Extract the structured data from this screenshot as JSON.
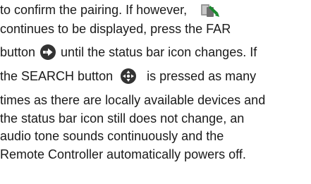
{
  "document": {
    "lines": [
      {
        "segments": [
          {
            "text": "to confirm the pairing. If however, "
          }
        ],
        "icon_after": "status-bar-pairing-icon"
      },
      {
        "segments": [
          {
            "text": "continues to be displayed, press the FAR"
          }
        ]
      },
      {
        "segments": [
          {
            "text": "button"
          },
          {
            "text": "until the status bar icon changes. If"
          }
        ],
        "icon_between": "far-button-icon"
      },
      {
        "segments": [
          {
            "text": "the SEARCH button"
          },
          {
            "text": "is pressed as many"
          }
        ],
        "icon_between": "search-button-icon"
      },
      {
        "segments": [
          {
            "text": "times as there are locally available devices and"
          }
        ]
      },
      {
        "segments": [
          {
            "text": "the status bar icon still does not change, an"
          }
        ]
      },
      {
        "segments": [
          {
            "text": "audio tone sounds continuously and the"
          }
        ]
      },
      {
        "segments": [
          {
            "text": "Remote Controller automatically powers off."
          }
        ]
      }
    ]
  },
  "colors": {
    "text": "#1a1a1a",
    "icon_dark": "#333333",
    "icon_gray": "#9a9a9a",
    "icon_green": "#1a8a2e"
  }
}
